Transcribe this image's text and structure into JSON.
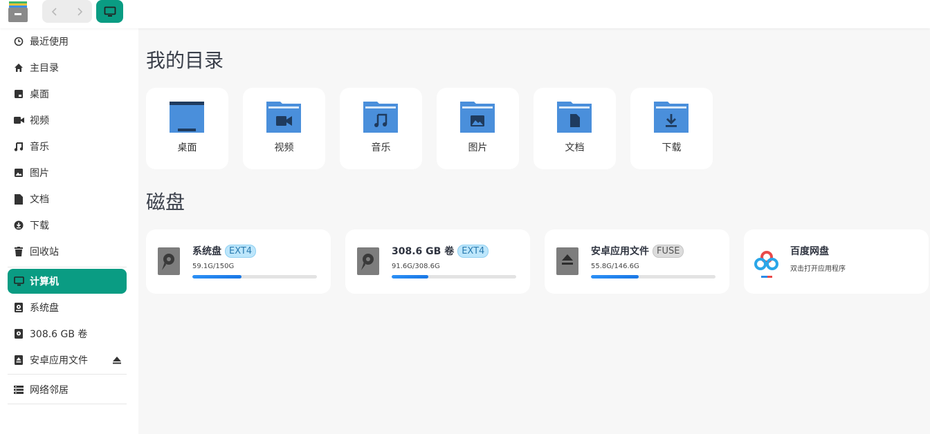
{
  "sidebar": {
    "items": [
      {
        "label": "最近使用",
        "icon": "clock-icon"
      },
      {
        "label": "主目录",
        "icon": "home-icon"
      },
      {
        "label": "桌面",
        "icon": "desktop-icon"
      },
      {
        "label": "视频",
        "icon": "video-icon"
      },
      {
        "label": "音乐",
        "icon": "music-icon"
      },
      {
        "label": "图片",
        "icon": "image-icon"
      },
      {
        "label": "文档",
        "icon": "document-icon"
      },
      {
        "label": "下载",
        "icon": "download-icon"
      },
      {
        "label": "回收站",
        "icon": "trash-icon"
      },
      {
        "label": "计算机",
        "icon": "computer-icon"
      },
      {
        "label": "系统盘",
        "icon": "system-disk-icon"
      },
      {
        "label": "308.6 GB 卷",
        "icon": "disk-icon"
      },
      {
        "label": "安卓应用文件",
        "icon": "removable-drive-icon"
      },
      {
        "label": "网络邻居",
        "icon": "network-icon"
      }
    ]
  },
  "main": {
    "my_dirs_title": "我的目录",
    "dirs": [
      {
        "label": "桌面",
        "icon": "desktop-folder-icon"
      },
      {
        "label": "视频",
        "icon": "video-folder-icon"
      },
      {
        "label": "音乐",
        "icon": "music-folder-icon"
      },
      {
        "label": "图片",
        "icon": "image-folder-icon"
      },
      {
        "label": "文档",
        "icon": "document-folder-icon"
      },
      {
        "label": "下载",
        "icon": "download-folder-icon"
      }
    ],
    "disks_title": "磁盘",
    "disks": [
      {
        "name": "系统盘",
        "fs": "EXT4",
        "size": "59.1G/150G",
        "usage": 0.394
      },
      {
        "name": "308.6 GB 卷",
        "fs": "EXT4",
        "size": "91.6G/308.6G",
        "usage": 0.297
      },
      {
        "name": "安卓应用文件",
        "fs": "FUSE",
        "size": "55.8G/146.6G",
        "usage": 0.381
      },
      {
        "name": "百度网盘",
        "subtitle": "双击打开应用程序"
      }
    ]
  },
  "colors": {
    "accent": "#0a9c83",
    "folder": "#4a8fdb",
    "bar": "#1f82ee"
  }
}
